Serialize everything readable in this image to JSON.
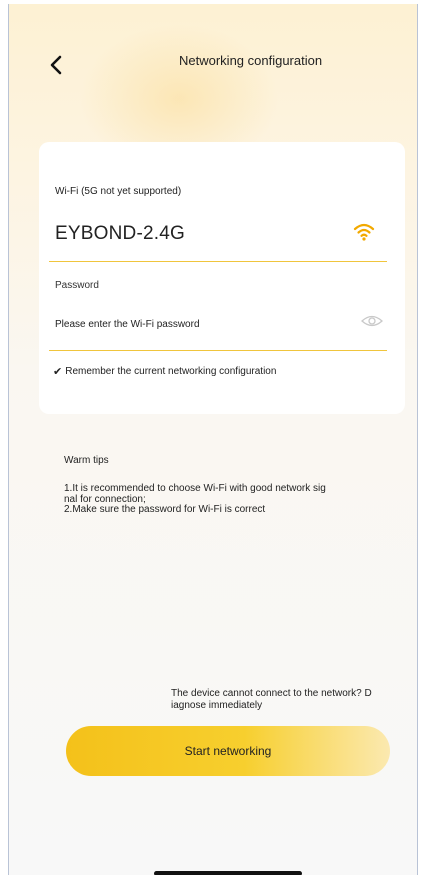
{
  "header": {
    "title": "Networking configuration"
  },
  "wifi": {
    "label": "Wi-Fi (5G not yet supported)",
    "ssid": "EYBOND-2.4G",
    "icon": "wifi-icon"
  },
  "password": {
    "label": "Password",
    "placeholder": "Please enter the Wi-Fi password",
    "value": "",
    "icon": "eye-icon"
  },
  "remember": {
    "checked": true,
    "label": "Remember the current networking configuration"
  },
  "tips": {
    "title": "Warm tips",
    "line1": "1.It is recommended to choose Wi-Fi with good network sig",
    "line2": "nal for connection;",
    "line3": "2.Make sure the password for Wi-Fi is correct"
  },
  "diagnose": {
    "line1": "The device cannot connect to the network? D",
    "line2": "iagnose immediately"
  },
  "actions": {
    "start_label": "Start networking"
  },
  "colors": {
    "accent": "#f4c11a",
    "divider": "#f0c53d",
    "wifi_icon": "#f2a900"
  }
}
